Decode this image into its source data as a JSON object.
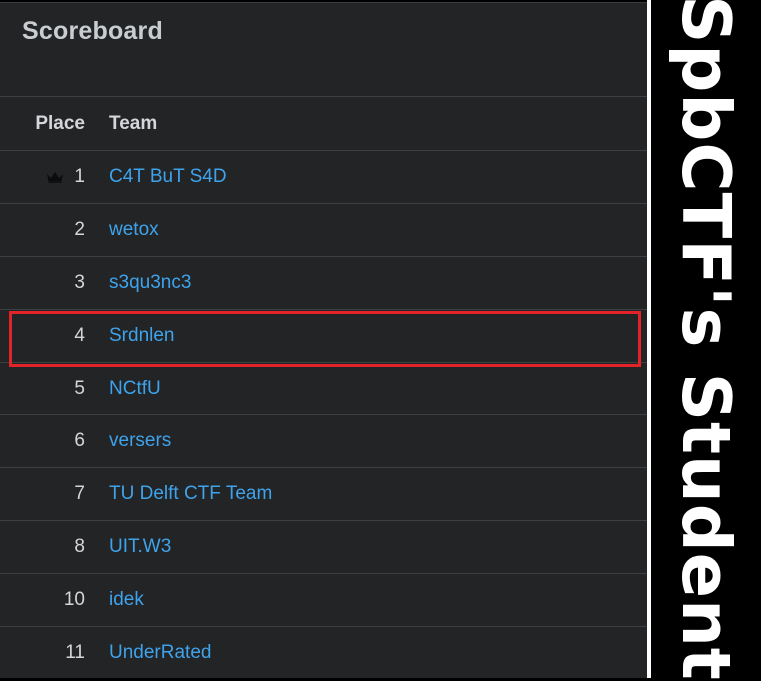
{
  "scoreboard": {
    "title": "Scoreboard",
    "columns": {
      "place": "Place",
      "team": "Team"
    },
    "rows": [
      {
        "place": "1",
        "team": "C4T BuT S4D",
        "crown": true
      },
      {
        "place": "2",
        "team": "wetox"
      },
      {
        "place": "3",
        "team": "s3qu3nc3"
      },
      {
        "place": "4",
        "team": "Srdnlen",
        "highlighted": true
      },
      {
        "place": "5",
        "team": "NCtfU"
      },
      {
        "place": "6",
        "team": "versers"
      },
      {
        "place": "7",
        "team": "TU Delft CTF Team"
      },
      {
        "place": "8",
        "team": "UIT.W3"
      },
      {
        "place": "10",
        "team": "idek"
      },
      {
        "place": "11",
        "team": "UnderRated"
      }
    ]
  },
  "side_caption": "SpbCTF's Student",
  "colors": {
    "panel_bg": "#222426",
    "team_link": "#3fa3ec",
    "highlight_border": "#e3232a",
    "side_bg": "#000000",
    "side_text": "#ffffff"
  },
  "icons": {
    "first_place": "crown-icon"
  }
}
